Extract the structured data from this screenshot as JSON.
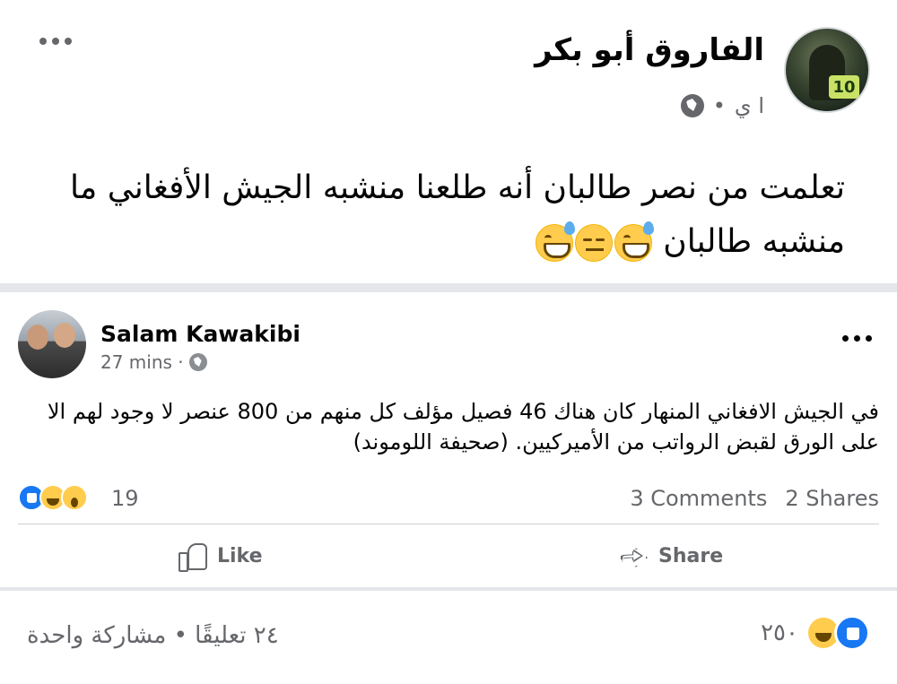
{
  "outer_post": {
    "author": "الفاروق أبو بكر",
    "timestamp": "ا ي",
    "audience_icon": "globe-icon",
    "text_line1": "تعلمت من نصر طالبان أنه طلعنا منشبه الجيش الأفغاني ما",
    "text_line2": "منشبه طالبان",
    "emojis": [
      "grinning-sweat-emoji",
      "expressionless-emoji",
      "grinning-sweat-emoji"
    ],
    "reactions": [
      "like-icon",
      "haha-icon"
    ],
    "reaction_count": "٢٥٠",
    "comments_shares": "٢٤ تعليقًا • مشاركة واحدة"
  },
  "shared_post": {
    "author": "Salam Kawakibi",
    "timestamp": "27 mins ·",
    "text": "في الجيش الافغاني المنهار كان هناك 46 فصيل مؤلف كل منهم من 800 عنصر لا وجود لهم الا على الورق لقبض الرواتب من الأميركيين. (صحيفة اللوموند)",
    "reactions": [
      "like-icon",
      "haha-icon",
      "wow-icon"
    ],
    "reaction_count": "19",
    "comments": "3 Comments",
    "shares": "2 Shares",
    "like_label": "Like",
    "share_label": "Share"
  },
  "colors": {
    "text": "#050505",
    "muted": "#65676b",
    "like_blue": "#1877f2",
    "emoji_yellow": "#ffcc4d",
    "divider": "#e4e6eb"
  }
}
